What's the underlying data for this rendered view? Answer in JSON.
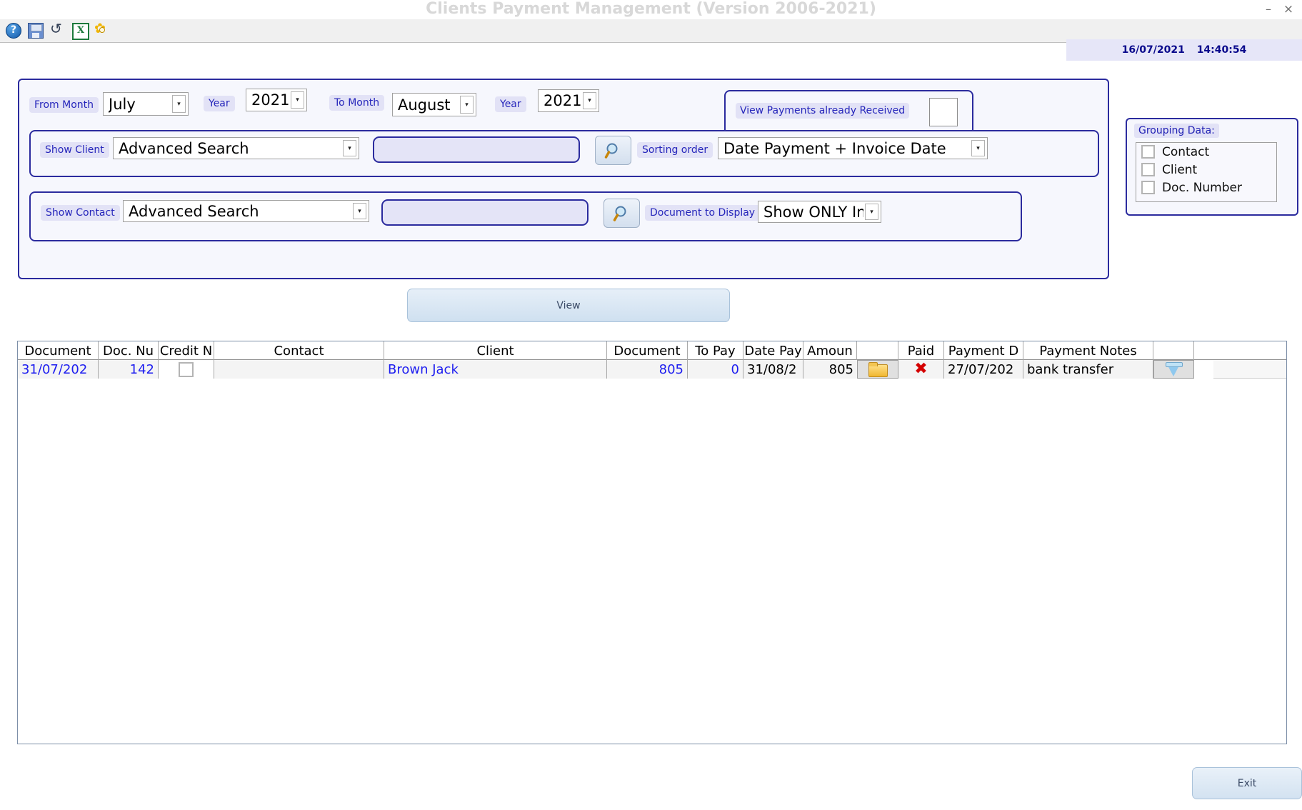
{
  "window": {
    "title": "Clients Payment Management (Version 2006-2021)",
    "minimize_label": "–",
    "close_label": "×"
  },
  "toolbar": {
    "help_icon": "help-icon",
    "save_icon": "save-icon",
    "undo_icon": "undo-icon",
    "excel_icon": "excel-export-icon",
    "excel_glyph": "X",
    "help_glyph": "?",
    "gear_icon": "gear-icon"
  },
  "statusbar": {
    "date": "16/07/2021",
    "time": "14:40:54"
  },
  "filters": {
    "from_month_label": "From Month",
    "from_month_value": "July",
    "from_year_label": "Year",
    "from_year_value": "2021",
    "to_month_label": "To Month",
    "to_month_value": "August",
    "to_year_label": "Year",
    "to_year_value": "2021",
    "view_payments_label": "View Payments already Received",
    "show_client_label": "Show Client",
    "show_client_value": "Advanced Search",
    "client_search_value": "",
    "client_search_placeholder": "",
    "sorting_order_label": "Sorting order",
    "sorting_order_value": "Date Payment + Invoice Date",
    "show_contact_label": "Show Contact",
    "show_contact_value": "Advanced Search",
    "contact_search_value": "",
    "contact_search_placeholder": "",
    "document_to_display_label": "Document to Display",
    "document_to_display_value": "Show ONLY Invoic",
    "arrow_glyph": "▾"
  },
  "grouping": {
    "title": "Grouping Data:",
    "items": [
      {
        "label": "Contact",
        "checked": false
      },
      {
        "label": "Client",
        "checked": false
      },
      {
        "label": "Doc. Number",
        "checked": false
      }
    ]
  },
  "actions": {
    "view_label": "View",
    "exit_label": "Exit"
  },
  "grid": {
    "columns": [
      "Document",
      "Doc. Nu",
      "Credit N",
      "Contact",
      "Client",
      "Document",
      "To Pay",
      "Date Pay",
      "Amoun",
      "",
      "Paid",
      "Payment D",
      "Payment Notes",
      "",
      ""
    ],
    "rows": [
      {
        "document_date": "31/07/202",
        "doc_number": "142",
        "credit_note": false,
        "contact": "",
        "client": "Brown Jack",
        "document_amount": "805",
        "to_pay": "0",
        "date_pay": "31/08/2",
        "amount": "805",
        "folder_icon": "folder-icon",
        "paid_icon": "red-x-icon",
        "payment_date": "27/07/202",
        "payment_notes": "bank transfer",
        "delete_icon": "trash-icon"
      }
    ]
  }
}
